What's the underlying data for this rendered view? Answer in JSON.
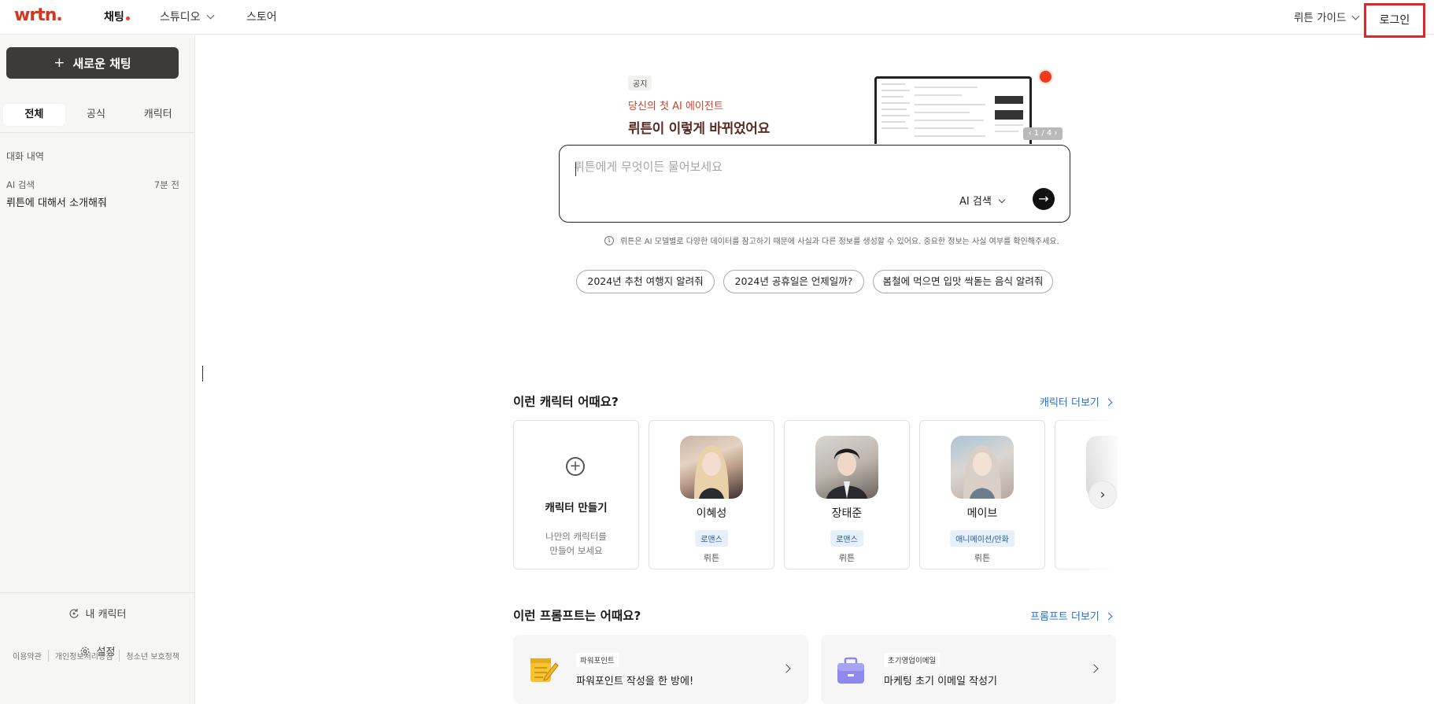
{
  "header": {
    "logo": "wrtn.",
    "nav": [
      {
        "label": "채팅"
      },
      {
        "label": "스튜디오"
      },
      {
        "label": "스토어"
      }
    ],
    "guide_label": "뤼튼 가이드",
    "login_label": "로그인"
  },
  "sidebar": {
    "new_chat_label": "새로운 채팅",
    "new_chat_icon": "+",
    "tabs": [
      {
        "label": "전체"
      },
      {
        "label": "공식"
      },
      {
        "label": "캐릭터"
      }
    ],
    "history_label": "대화 내역",
    "history": [
      {
        "category": "AI 검색",
        "time": "7분 전",
        "title": "뤼튼에 대해서 소개해줘"
      }
    ],
    "my_character_label": "내 캐릭터",
    "settings_label": "설정",
    "footer_links": [
      "이용약관",
      "개인정보처리방침",
      "청소년 보호정책"
    ]
  },
  "notice": {
    "badge": "공지",
    "subtitle": "당신의 첫 AI 에이전트",
    "title": "뤼튼이 이렇게 바뀌었어요",
    "pager": "‹ 1 / 4 ›"
  },
  "ask": {
    "placeholder": "뤼튼에게 무엇이든 물어보세요",
    "mode_label": "AI 검색",
    "send_icon": "→"
  },
  "disclaimer": "뤼튼은 AI 모델별로 다양한 데이터를 참고하기 때문에 사실과 다른 정보를 생성할 수 있어요. 중요한 정보는 사실 여부를 확인해주세요.",
  "suggestions": [
    "2024년 추천 여행지 알려줘",
    "2024년 공휴일은 언제일까?",
    "봄철에 먹으면 입맛 싹돋는 음식 알려줘"
  ],
  "characters_section": {
    "title": "이런 캐릭터 어때요?",
    "more_label": "캐릭터 더보기",
    "create_card": {
      "title": "캐릭터 만들기",
      "desc_line1": "나만의 캐릭터를",
      "desc_line2": "만들어 보세요"
    },
    "cards": [
      {
        "name": "이혜성",
        "tag": "로맨스",
        "author": "뤼튼"
      },
      {
        "name": "장태준",
        "tag": "로맨스",
        "author": "뤼튼"
      },
      {
        "name": "메이브",
        "tag": "애니메이션/만화",
        "author": "뤼튼"
      }
    ]
  },
  "prompts_section": {
    "title": "이런 프롬프트는 어때요?",
    "more_label": "프롬프트 더보기",
    "cards": [
      {
        "tag": "파워포인트",
        "title": "파워포인트 작성을 한 방에!"
      },
      {
        "tag": "초기영업이메일",
        "title": "마케팅 초기 이메일 작성기"
      }
    ]
  },
  "colors": {
    "brand": "#d6351f",
    "link": "#1f6fd1",
    "highlight_border": "#e0262c"
  }
}
